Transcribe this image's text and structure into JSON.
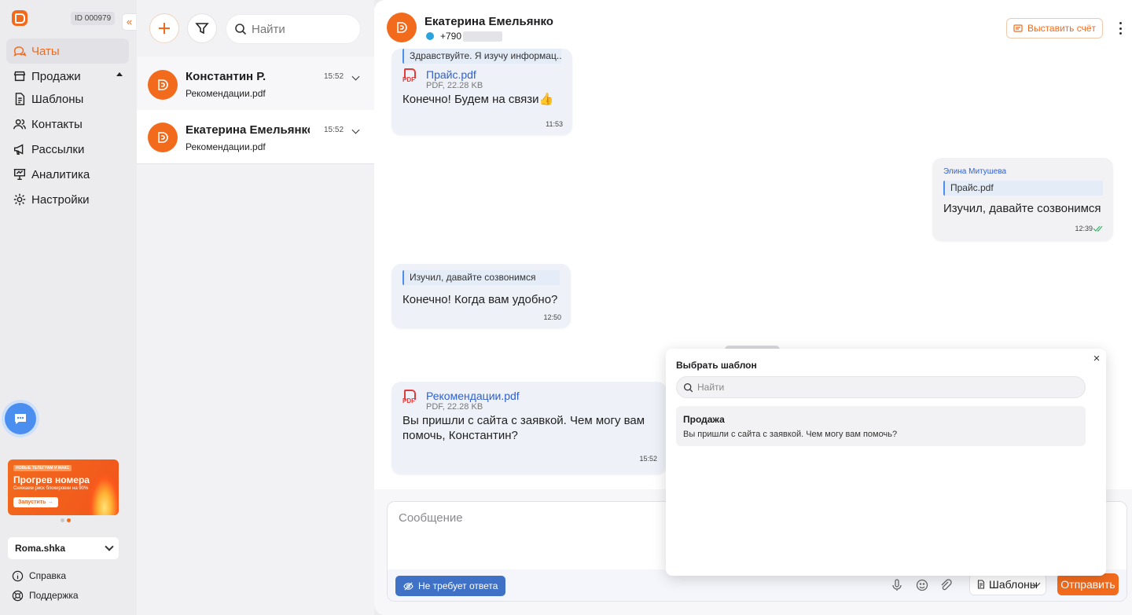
{
  "sidebar": {
    "account_id": "ID 000979",
    "collapse_glyph": "«",
    "items": [
      {
        "label": "Чаты",
        "icon": "chat-icon",
        "active": true
      },
      {
        "label": "Продажи",
        "icon": "store-icon"
      },
      {
        "label": "Шаблоны",
        "icon": "document-icon"
      },
      {
        "label": "Контакты",
        "icon": "contacts-icon"
      },
      {
        "label": "Рассылки",
        "icon": "megaphone-icon"
      },
      {
        "label": "Аналитика",
        "icon": "analytics-icon"
      },
      {
        "label": "Настройки",
        "icon": "settings-icon"
      }
    ],
    "promo": {
      "tag": "НОВЫЕ ТЕЛЕГРАМ И МАКС",
      "title": "Прогрев номера",
      "subtitle": "Снижаем риск блокировки на 90%",
      "button": "Запустить →"
    },
    "account_name": "Roma.shka",
    "footer": {
      "help": "Справка",
      "support": "Поддержка"
    }
  },
  "chatlist": {
    "search_placeholder": "Найти",
    "chats": [
      {
        "name": "Константин Р.",
        "last_message": "Рекомендации.pdf",
        "time": "15:52"
      },
      {
        "name": "Екатерина Емельянко",
        "last_message": "Рекомендации.pdf",
        "time": "15:52"
      }
    ]
  },
  "header": {
    "name": "Екатерина Емельянко",
    "phone": "+790",
    "invoice_button": "Выставить счёт"
  },
  "messages": {
    "m1": {
      "quote": "Здравствуйте. Я изучу информац...",
      "file_name": "Прайс.pdf",
      "file_size": "PDF, 22.28 KB",
      "text": "Конечно! Будем на связи👍",
      "time": "11:53"
    },
    "m2": {
      "sender": "Элина Митушева",
      "quote": "Прайс.pdf",
      "text": "Изучил, давайте созвонимся",
      "time": "12:39"
    },
    "m3": {
      "quote": "Изучил, давайте созвонимся",
      "text": "Конечно! Когда вам удобно?",
      "time": "12:50"
    },
    "m4": {
      "file_name": "Рекомендации.pdf",
      "file_size": "PDF, 22.28 KB",
      "text_line1": "Вы пришли с сайта с заявкой. Чем могу вам",
      "text_line2": "помочь, Константин?",
      "time": "15:52"
    },
    "pdf_label": "PDF"
  },
  "composer": {
    "placeholder": "Сообщение",
    "no_reply_button": "Не требует ответа",
    "templates_button": "Шаблоны",
    "send_button": "Отправить"
  },
  "template_popup": {
    "title": "Выбрать шаблон",
    "close": "×",
    "search_placeholder": "Найти",
    "items": [
      {
        "title": "Продажа",
        "text": "Вы пришли с сайта с заявкой. Чем могу вам помочь?"
      }
    ]
  },
  "colors": {
    "accent": "#f26b1d",
    "link": "#2f5fd0",
    "primary_blue": "#3f72c6"
  }
}
